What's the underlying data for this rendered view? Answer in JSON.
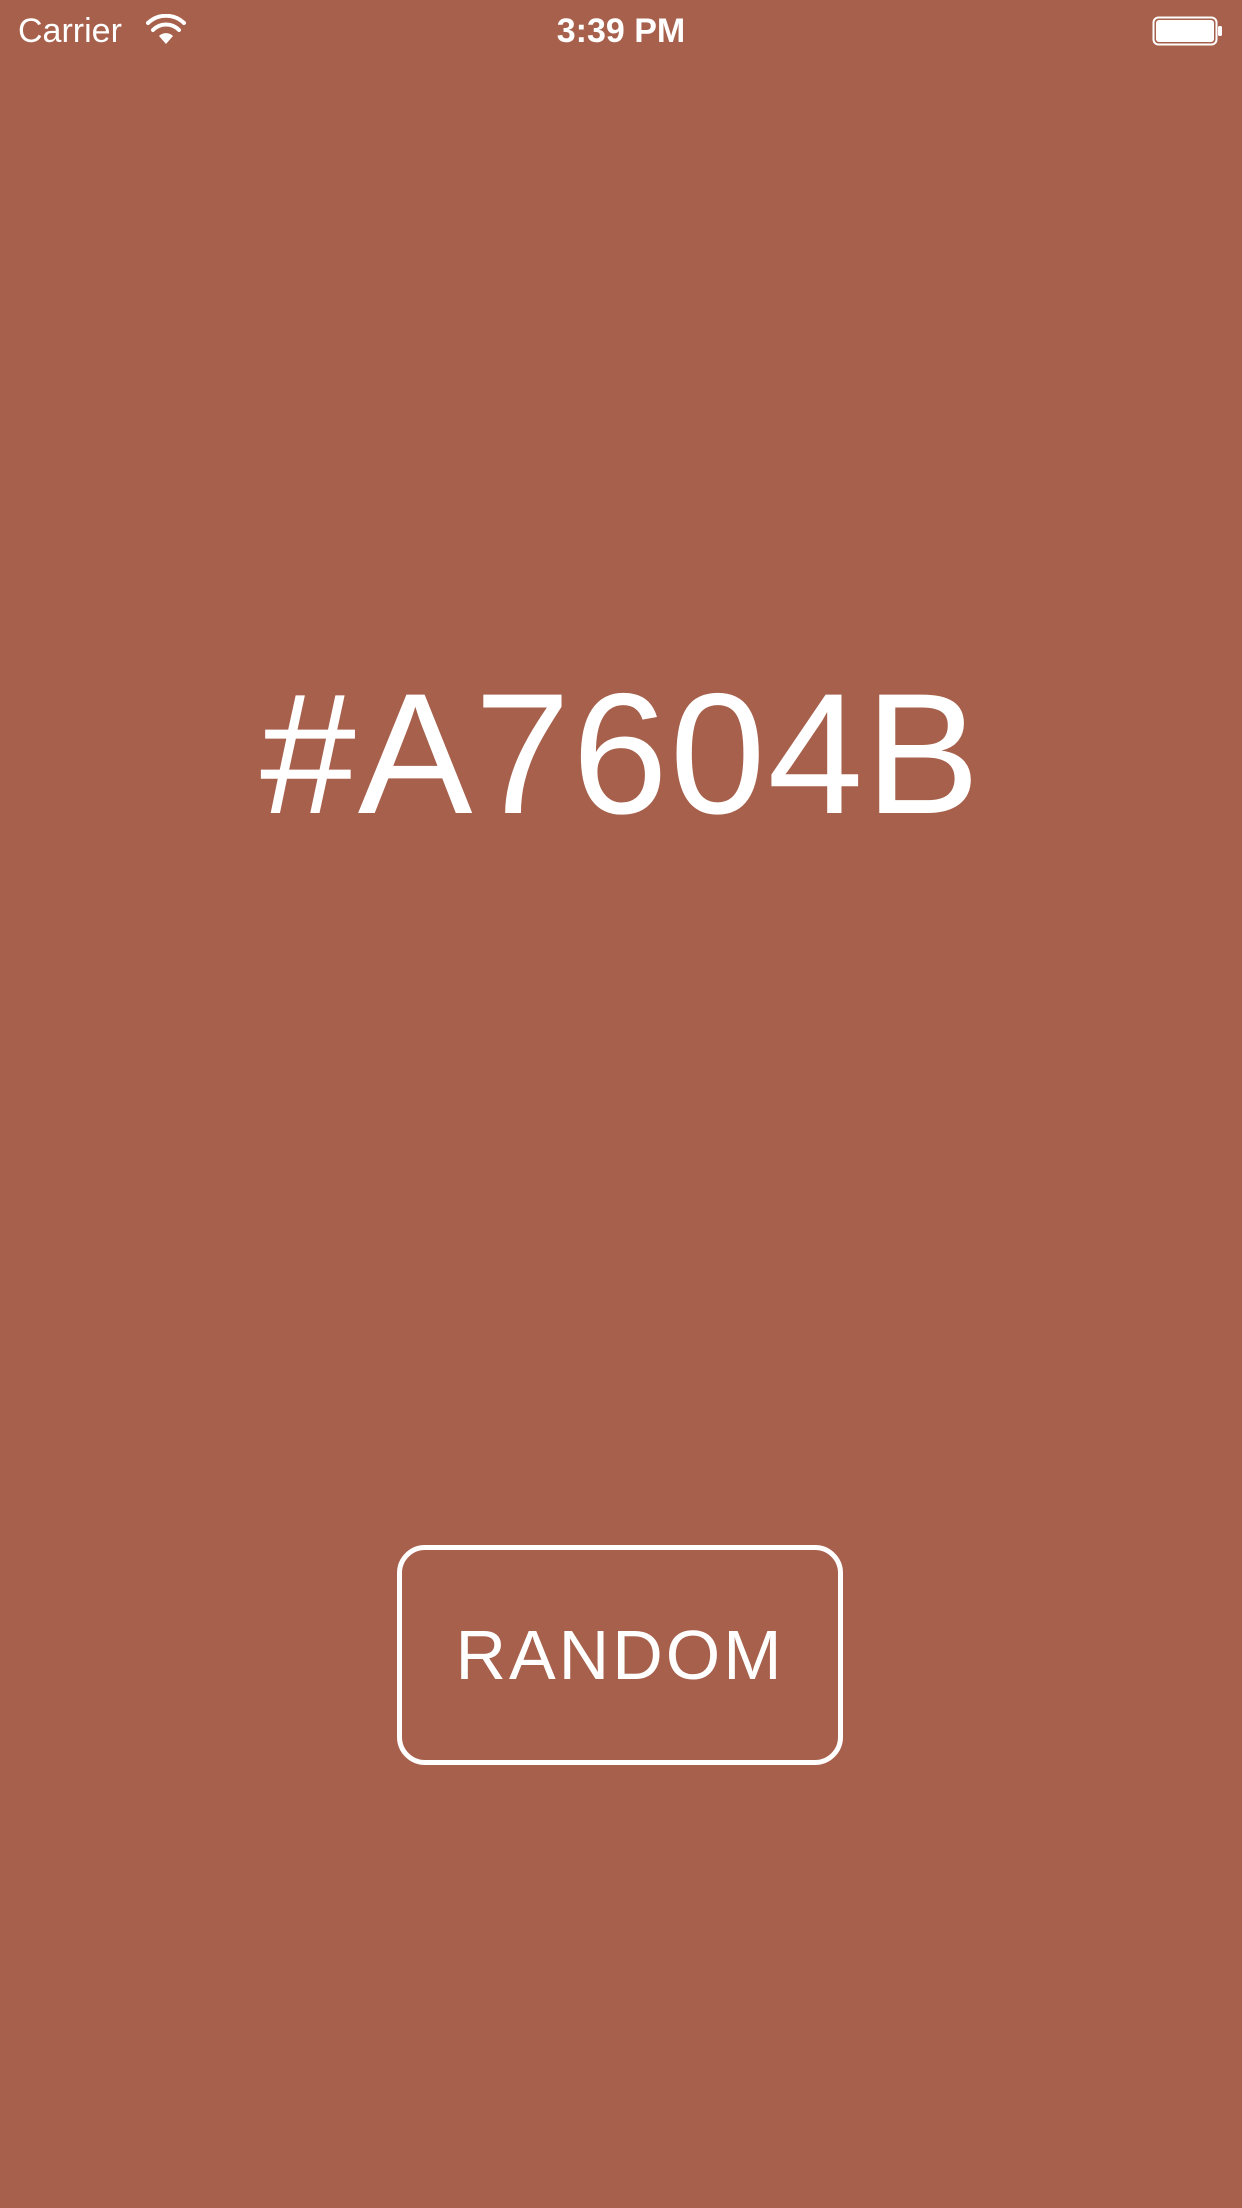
{
  "status_bar": {
    "carrier": "Carrier",
    "time": "3:39 PM",
    "wifi_icon": "wifi-icon",
    "battery_icon": "battery-icon"
  },
  "color": {
    "hex_label": "#A7604B",
    "background": "#A7604B",
    "foreground": "#FFFFFF"
  },
  "actions": {
    "random_label": "RANDOM"
  }
}
